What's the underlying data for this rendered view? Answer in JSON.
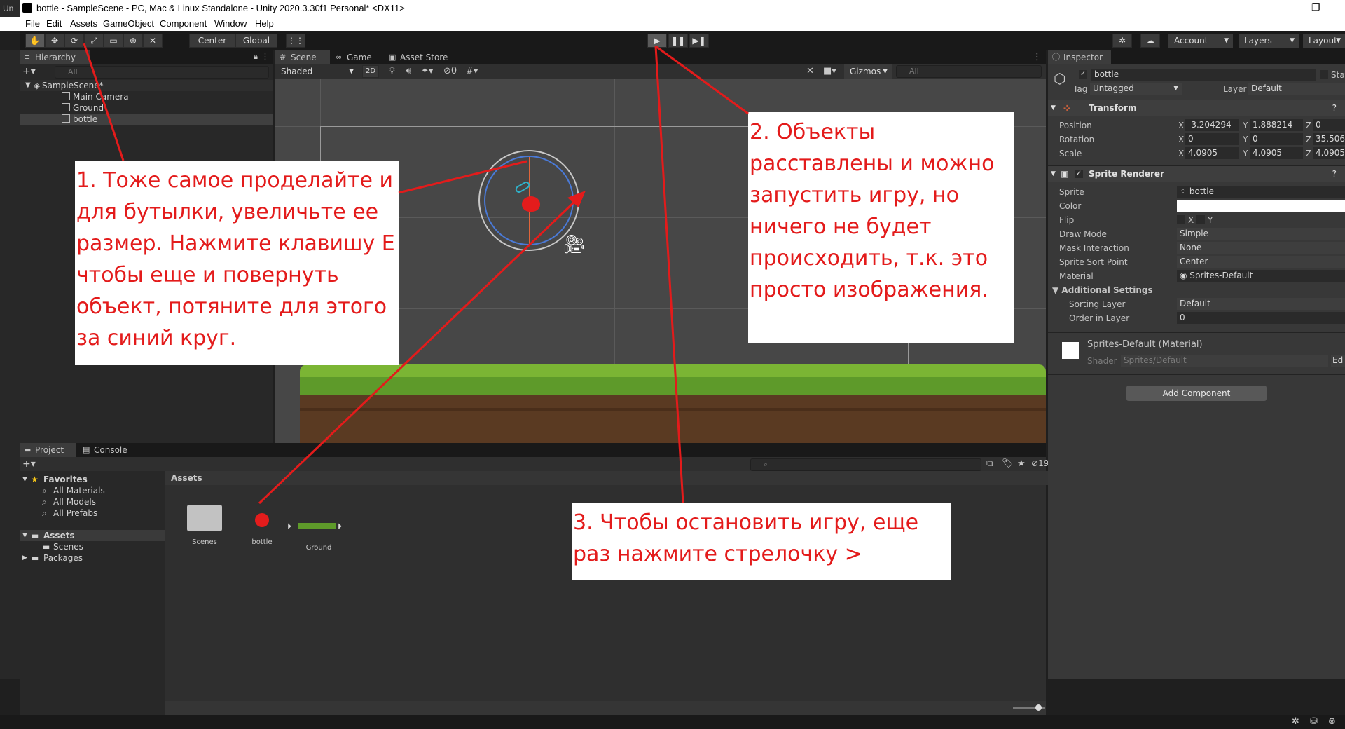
{
  "window": {
    "title": "bottle - SampleScene - PC, Mac & Linux Standalone - Unity 2020.3.30f1 Personal* <DX11>",
    "left_strip_text": "Un"
  },
  "menu": [
    "File",
    "Edit",
    "Assets",
    "GameObject",
    "Component",
    "Window",
    "Help"
  ],
  "toolbar": {
    "center_label": "Center",
    "global_label": "Global",
    "account_label": "Account",
    "layers_label": "Layers",
    "layout_label": "Layout"
  },
  "hierarchy": {
    "tab": "Hierarchy",
    "search_placeholder": "All",
    "scene_name": "SampleScene*",
    "items": [
      "Main Camera",
      "Ground",
      "bottle"
    ]
  },
  "scene_view": {
    "tabs": [
      "Scene",
      "Game",
      "Asset Store"
    ],
    "shading": "Shaded",
    "mode_2d": "2D",
    "hidden_count": "0",
    "gizmos_label": "Gizmos",
    "search_placeholder": "All"
  },
  "project": {
    "tabs": [
      "Project",
      "Console"
    ],
    "favorites_label": "Favorites",
    "favorites": [
      "All Materials",
      "All Models",
      "All Prefabs"
    ],
    "assets_label": "Assets",
    "assets_children": [
      "Scenes"
    ],
    "packages_label": "Packages",
    "breadcrumb": "Assets",
    "hidden_count": "19",
    "files": [
      "Scenes",
      "bottle",
      "Ground"
    ]
  },
  "inspector": {
    "tab": "Inspector",
    "object_name": "bottle",
    "static_label": "Stati",
    "tag_label": "Tag",
    "tag_value": "Untagged",
    "layer_label": "Layer",
    "layer_value": "Default",
    "transform": {
      "title": "Transform",
      "position_label": "Position",
      "rotation_label": "Rotation",
      "scale_label": "Scale",
      "position": [
        "-3.204294",
        "1.888214",
        "0"
      ],
      "rotation": [
        "0",
        "0",
        "35.506"
      ],
      "scale": [
        "4.0905",
        "4.0905",
        "4.0905"
      ],
      "axes": [
        "X",
        "Y",
        "Z"
      ]
    },
    "sprite_renderer": {
      "title": "Sprite Renderer",
      "sprite_label": "Sprite",
      "sprite_value": "bottle",
      "color_label": "Color",
      "flip_label": "Flip",
      "flip_x": "X",
      "flip_y": "Y",
      "draw_mode_label": "Draw Mode",
      "draw_mode": "Simple",
      "mask_label": "Mask Interaction",
      "mask_value": "None",
      "sort_point_label": "Sprite Sort Point",
      "sort_point": "Center",
      "material_label": "Material",
      "material_value": "Sprites-Default",
      "additional_label": "Additional Settings",
      "sorting_layer_label": "Sorting Layer",
      "sorting_layer": "Default",
      "order_label": "Order in Layer",
      "order_value": "0"
    },
    "material": {
      "name": "Sprites-Default (Material)",
      "shader_label": "Shader",
      "shader_value": "Sprites/Default",
      "edit_label": "Ed"
    },
    "add_component": "Add Component"
  },
  "annotations": {
    "note1": "1. Тоже самое проделайте и для бутылки, увеличьте ее размер. Нажмите клавишу E чтобы еще и повернуть объект, потяните для этого за синий круг.",
    "note2": "2. Объекты расставлены и можно запустить игру, но ничего не будет происходить, т.к. это просто изображения.",
    "note3": "3. Чтобы остановить игру, еще раз нажмите стрелочку >"
  },
  "colors": {
    "annotation_red": "#e31b1b",
    "editor_dark": "#282828",
    "scene_bg": "#474747",
    "grass": "#6fa22f",
    "dirt": "#5a3a22"
  }
}
